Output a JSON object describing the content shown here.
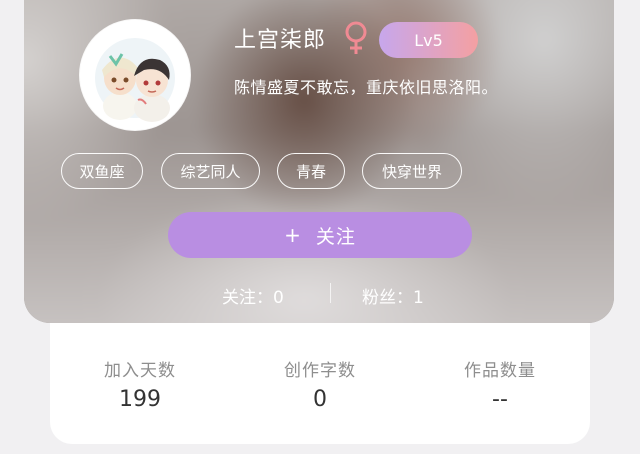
{
  "profile": {
    "username": "上宫柒郎",
    "gender_icon": "female-symbol-icon",
    "gender_color": "#f08a93",
    "level": "Lv5",
    "bio": "陈情盛夏不敢忘，重庆依旧思洛阳。"
  },
  "tags": [
    "双鱼座",
    "综艺同人",
    "青春",
    "快穿世界"
  ],
  "follow_button": {
    "plus": "+",
    "label": "关注",
    "color": "#b98ee2"
  },
  "social": {
    "following": "关注：0",
    "fans": "粉丝：1"
  },
  "stats": [
    {
      "label": "加入天数",
      "value": "199"
    },
    {
      "label": "创作字数",
      "value": "0"
    },
    {
      "label": "作品数量",
      "value": "--"
    }
  ]
}
